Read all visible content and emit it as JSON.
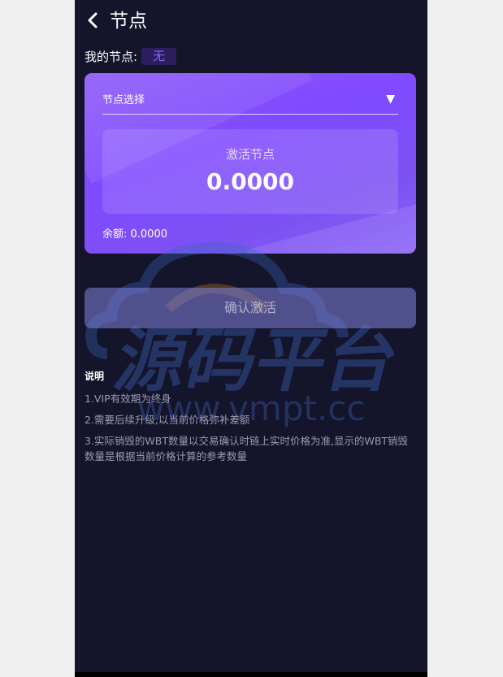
{
  "header": {
    "title": "节点"
  },
  "my_node": {
    "label": "我的节点:",
    "value": "无"
  },
  "card": {
    "select_label": "节点选择",
    "activate_label": "激活节点",
    "activate_value": "0.0000",
    "balance": "余额: 0.0000"
  },
  "confirm_button": "确认激活",
  "notes": {
    "title": "说明",
    "items": [
      "1.VIP有效期为终身",
      "2.需要后续升级,以当前价格弥补差额",
      "3.实际销毁的WBT数量以交易确认时链上实时价格为准,显示的WBT销毁数量是根据当前价格计算的参考数量"
    ]
  },
  "watermark": {
    "title": "源码平台",
    "url": "www.vmpt.cc"
  },
  "colors": {
    "background": "#14142a",
    "card_accent": "#8049ff",
    "badge_text": "#8c63ff"
  },
  "icons": {
    "back": "chevron-left-icon",
    "dropdown": "triangle-down-icon"
  }
}
